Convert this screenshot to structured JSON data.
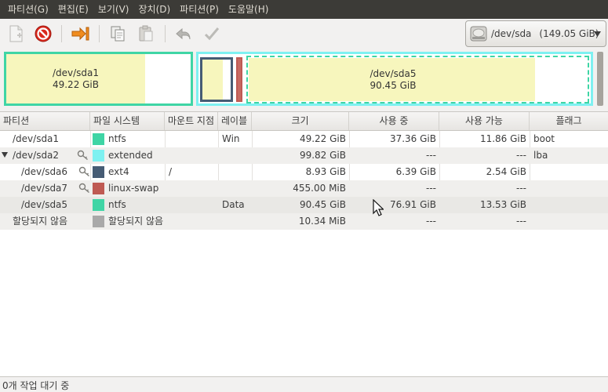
{
  "menu": [
    "파티션(G)",
    "편집(E)",
    "보기(V)",
    "장치(D)",
    "파티션(P)",
    "도움말(H)"
  ],
  "toolbar": {
    "icons": [
      "new-partition-icon",
      "delete-icon",
      "resize-move-icon",
      "copy-icon",
      "paste-icon",
      "undo-icon",
      "apply-icon"
    ]
  },
  "device": {
    "name": "/dev/sda",
    "size": "(149.05 GiB)",
    "icon": "harddisk-icon"
  },
  "diskmap": {
    "sda1": {
      "name": "/dev/sda1",
      "size": "49.22 GiB",
      "color": "#3fd5a5"
    },
    "sda5": {
      "name": "/dev/sda5",
      "size": "90.45 GiB",
      "color": "#3fd5a5"
    },
    "extended_color": "#7ef1f1",
    "ext4_color": "#465c74",
    "swap_color": "#bf5a53",
    "used_color": "#f7f6bd"
  },
  "table": {
    "columns": [
      "파티션",
      "파일 시스템",
      "마운트 지점",
      "레이블",
      "크기",
      "사용 중",
      "사용 가능",
      "플래그"
    ],
    "rows": [
      {
        "partition": "/dev/sda1",
        "filesystem": "ntfs",
        "fs_color": "#3fd5a5",
        "mount": "",
        "label": "Win",
        "size": "49.22 GiB",
        "used": "37.36 GiB",
        "free": "11.86 GiB",
        "flags": "boot"
      },
      {
        "partition": "/dev/sda2",
        "filesystem": "extended",
        "fs_color": "#7ef1f1",
        "mount": "",
        "label": "",
        "size": "99.82 GiB",
        "used": "---",
        "free": "---",
        "flags": "lba"
      },
      {
        "partition": "/dev/sda6",
        "filesystem": "ext4",
        "fs_color": "#465c74",
        "mount": "/",
        "label": "",
        "size": "8.93 GiB",
        "used": "6.39 GiB",
        "free": "2.54 GiB",
        "flags": ""
      },
      {
        "partition": "/dev/sda7",
        "filesystem": "linux-swap",
        "fs_color": "#bf5a53",
        "mount": "",
        "label": "",
        "size": "455.00 MiB",
        "used": "---",
        "free": "---",
        "flags": ""
      },
      {
        "partition": "/dev/sda5",
        "filesystem": "ntfs",
        "fs_color": "#3fd5a5",
        "mount": "",
        "label": "Data",
        "size": "90.45 GiB",
        "used": "76.91 GiB",
        "free": "13.53 GiB",
        "flags": ""
      },
      {
        "partition": "할당되지 않음",
        "filesystem": "할당되지 않음",
        "fs_color": "#a9a9a9",
        "mount": "",
        "label": "",
        "size": "10.34 MiB",
        "used": "---",
        "free": "---",
        "flags": ""
      }
    ]
  },
  "status": "0개 작업 대기 중"
}
